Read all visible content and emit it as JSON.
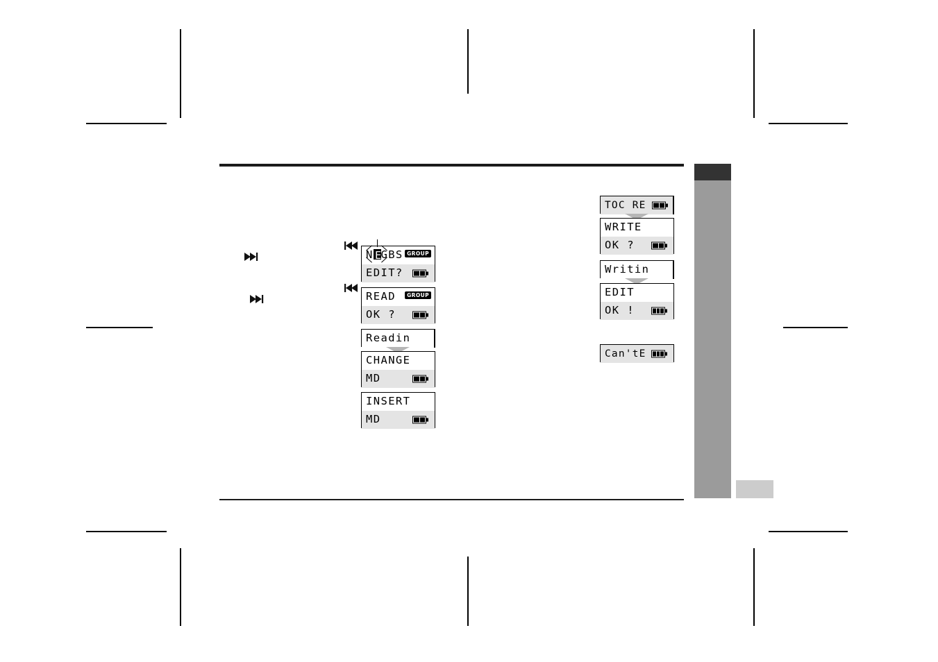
{
  "document": {
    "type": "minidisc-manual-page",
    "title": "MD Group Edit Display Sequence"
  },
  "colors": {
    "rule": "#1b1b1b",
    "tab_dark": "#333333",
    "tab_gray": "#9b9b9b",
    "tab_light": "#cccccc",
    "lcd_shade": "#e4e4e4",
    "connector": "#b6b6b6"
  },
  "transport_icons": {
    "next": "next-track-icon",
    "prev": "previous-track-icon"
  },
  "left_column": {
    "steps": [
      {
        "icon_label": "next-track",
        "id": "step-next-1"
      },
      {
        "icon_label": "next-track",
        "id": "step-next-2"
      }
    ],
    "displays": [
      {
        "id": "disp-negbs-edit",
        "prev_icon": "previous-track",
        "badge": "GROUP",
        "rows": [
          {
            "text": "NEGBS",
            "shaded": false,
            "blink_index": 1,
            "blink_char": "E"
          },
          {
            "text": "EDIT?",
            "shaded": true,
            "battery": 2
          }
        ]
      },
      {
        "id": "disp-read-ok",
        "prev_icon": "previous-track",
        "badge": "GROUP",
        "rows": [
          {
            "text": "READ",
            "shaded": false
          },
          {
            "text": "OK ?",
            "shaded": true,
            "battery": 2
          }
        ]
      },
      {
        "id": "disp-readin",
        "cut_right": true,
        "connector_below": true,
        "rows": [
          {
            "text": "Readin",
            "shaded": false
          }
        ]
      },
      {
        "id": "disp-change-md",
        "rows": [
          {
            "text": "CHANGE",
            "shaded": false
          },
          {
            "text": "MD",
            "shaded": true,
            "battery": 2
          }
        ]
      },
      {
        "id": "disp-insert-md",
        "rows": [
          {
            "text": "INSERT",
            "shaded": false
          },
          {
            "text": "MD",
            "shaded": true,
            "battery": 2
          }
        ]
      }
    ]
  },
  "right_column": {
    "displays": [
      {
        "id": "disp-toc-re",
        "cut_right": true,
        "connector_below": true,
        "rows": [
          {
            "text": "TOC RE",
            "shaded": true,
            "battery": 2
          }
        ]
      },
      {
        "id": "disp-write-ok",
        "rows": [
          {
            "text": "WRITE",
            "shaded": false
          },
          {
            "text": "OK ?",
            "shaded": true,
            "battery": 2
          }
        ]
      },
      {
        "id": "disp-writin",
        "cut_right": true,
        "connector_below": true,
        "rows": [
          {
            "text": "Writin",
            "shaded": false
          }
        ]
      },
      {
        "id": "disp-edit-ok",
        "rows": [
          {
            "text": "EDIT",
            "shaded": false
          },
          {
            "text": "OK !",
            "shaded": true,
            "battery": 3
          }
        ]
      },
      {
        "id": "disp-cant-e",
        "rows": [
          {
            "text": "Can'tE",
            "shaded": true,
            "battery": 3
          }
        ]
      }
    ]
  }
}
